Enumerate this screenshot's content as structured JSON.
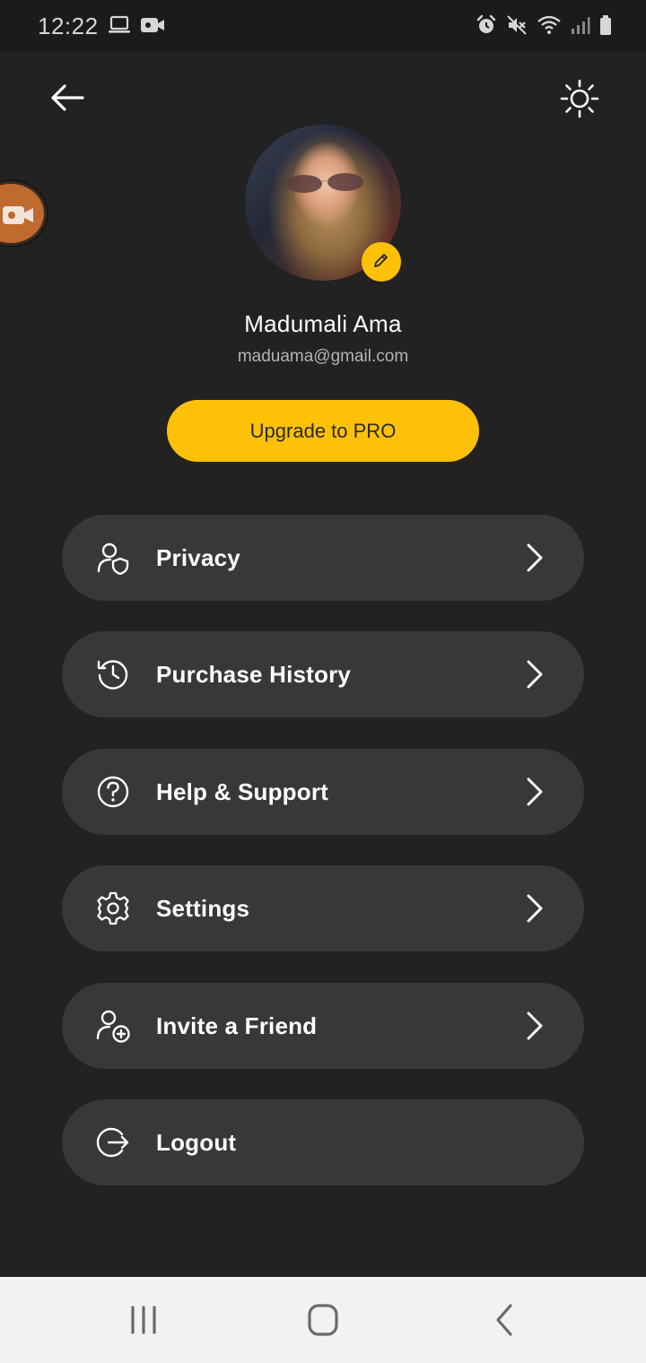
{
  "status_bar": {
    "time": "12:22",
    "left_icons": [
      "laptop-icon",
      "video-camera-icon"
    ],
    "right_icons": [
      "alarm-icon",
      "mute-icon",
      "wifi-icon",
      "signal-icon",
      "battery-icon"
    ]
  },
  "header": {
    "back_icon": "arrow-left-icon",
    "theme_icon": "sun-icon"
  },
  "profile": {
    "name": "Madumali Ama",
    "email": "maduama@gmail.com",
    "edit_icon": "pencil-icon"
  },
  "upgrade": {
    "label": "Upgrade to PRO"
  },
  "menu": {
    "items": [
      {
        "label": "Privacy",
        "icon": "user-shield-icon"
      },
      {
        "label": "Purchase History",
        "icon": "history-icon"
      },
      {
        "label": "Help & Support",
        "icon": "help-circle-icon"
      },
      {
        "label": "Settings",
        "icon": "gear-icon"
      },
      {
        "label": "Invite a Friend",
        "icon": "user-plus-icon"
      },
      {
        "label": "Logout",
        "icon": "logout-icon"
      }
    ]
  },
  "nav_bar": {
    "buttons": [
      "recent-apps-icon",
      "home-icon",
      "back-nav-icon"
    ]
  },
  "colors": {
    "background": "#222222",
    "card": "#383838",
    "accent": "#ffc107",
    "text": "#ffffff",
    "muted_text": "#b4b4b4"
  }
}
